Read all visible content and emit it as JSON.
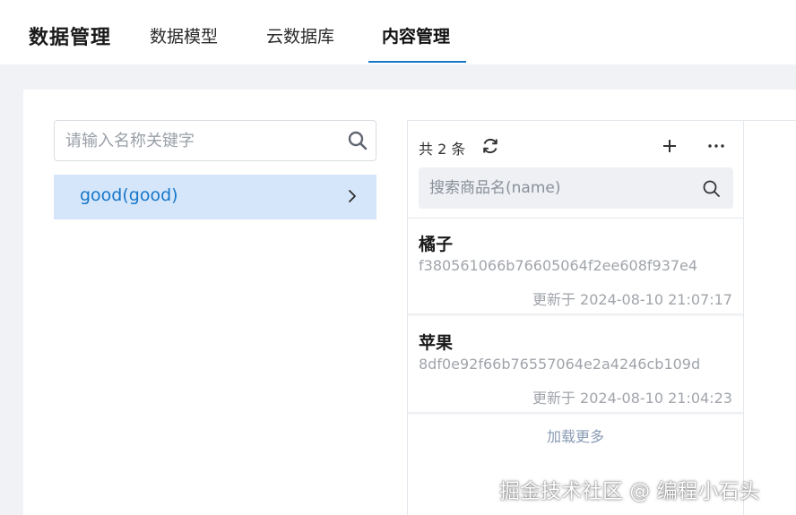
{
  "header": {
    "title": "数据管理",
    "tabs": [
      {
        "label": "数据模型"
      },
      {
        "label": "云数据库"
      },
      {
        "label": "内容管理"
      }
    ],
    "active_tab": "内容管理",
    "accent_color": "#1677c9"
  },
  "left_panel": {
    "search_placeholder": "请输入名称关键字",
    "model_item_label": "good(good)"
  },
  "list_panel": {
    "count_text": "共 2 条",
    "search_placeholder": "搜索商品名(name)",
    "records": [
      {
        "title": "橘子",
        "id": "f380561066b76605064f2ee608f937e4",
        "updated": "更新于 2024-08-10 21:07:17"
      },
      {
        "title": "苹果",
        "id": "8df0e92f66b76557064e2a4246cb109d",
        "updated": "更新于 2024-08-10 21:04:23"
      }
    ],
    "load_more": "加载更多"
  },
  "watermark": "掘金技术社区 @ 编程小石头",
  "icons": [
    "search-icon",
    "chevron-right-icon",
    "refresh-icon",
    "plus-icon",
    "more-icon"
  ]
}
